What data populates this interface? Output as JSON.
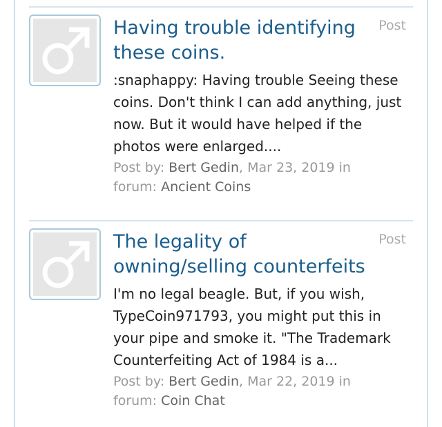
{
  "results": [
    {
      "title": "Having trouble identifying these coins.",
      "type_label": "Post",
      "snippet": ":snaphappy: Having trouble Seeing these coins. Don't think I can add anything, just now. But it would have helped if the photos were enlarged....",
      "post_by_label": "Post by:",
      "author": "Bert Gedin",
      "date": "Mar 23, 2019",
      "in_label": "in",
      "forum_label": "forum:",
      "forum": "Ancient Coins"
    },
    {
      "title": "The legality of owning/selling counterfeits",
      "type_label": "Post",
      "snippet": "I'm no legal beagle. But, if you wish, TypeCoin971793, you might put this in your pipe and smoke it. \"The Trademark Counterfeiting Act of 1984 is a...",
      "post_by_label": "Post by:",
      "author": "Bert Gedin",
      "date": "Mar 22, 2019",
      "in_label": "in",
      "forum_label": "forum:",
      "forum": "Coin Chat"
    }
  ],
  "icons": {
    "avatar_placeholder": "male-symbol-icon"
  },
  "colors": {
    "title": "#1b5e8c",
    "meta": "#999999",
    "meta_value": "#666666",
    "border": "#a9c9da"
  }
}
